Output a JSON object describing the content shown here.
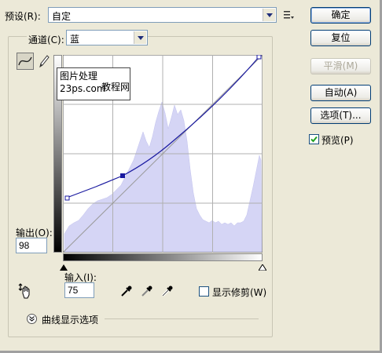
{
  "preset": {
    "label": "预设(R):",
    "value": "自定"
  },
  "channel": {
    "label": "通道(C):",
    "value": "蓝"
  },
  "buttons": {
    "ok": "确定",
    "reset": "复位",
    "smooth": "平滑(M)",
    "auto": "自动(A)",
    "options": "选项(T)..."
  },
  "preview": {
    "label": "预览(P)",
    "checked": true
  },
  "output": {
    "label": "输出(O):",
    "value": "98"
  },
  "input": {
    "label": "输入(I):",
    "value": "75"
  },
  "show_clipping": {
    "label": "显示修剪(W)",
    "checked": false
  },
  "curve_options": {
    "label": "曲线显示选项"
  },
  "watermark": {
    "line1": "图片处理",
    "line2": "23ps.com",
    "line3": "教程网"
  },
  "colors": {
    "curve": "#1a1aa0",
    "histogram": "#d5d5f5",
    "accent": "#003c74"
  }
}
